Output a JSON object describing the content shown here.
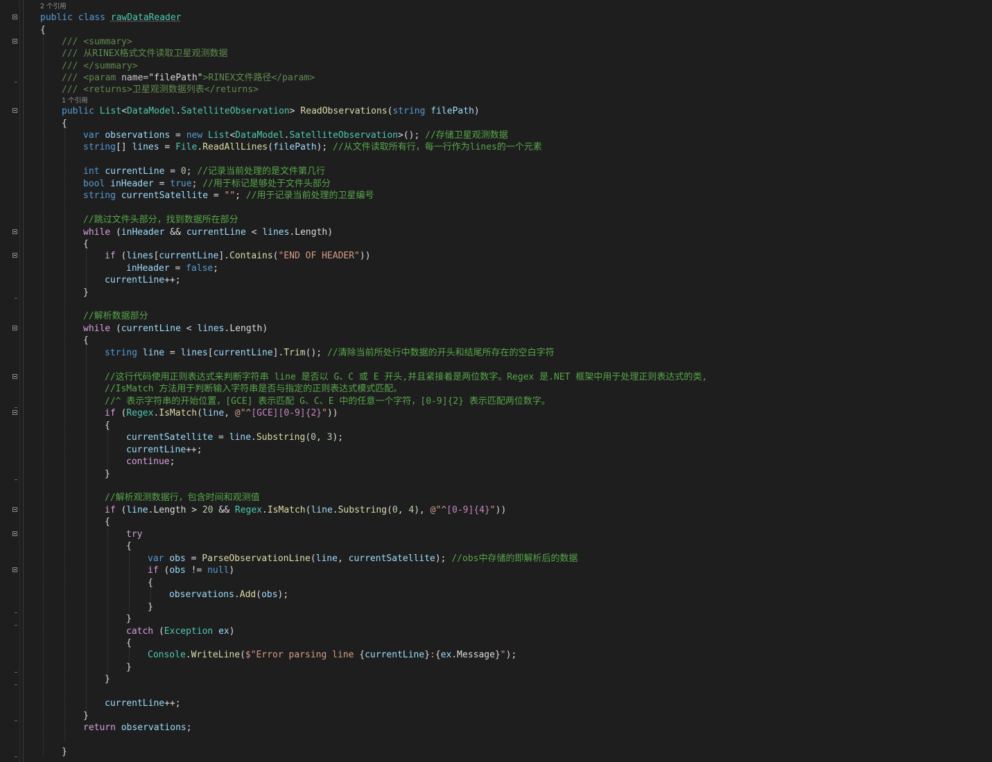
{
  "lens": {
    "class_refs": "2 个引用",
    "method_refs": "1 个引用"
  },
  "code": {
    "l01": [
      "public",
      "class",
      "rawDataReader"
    ],
    "l02": "{",
    "l03": "/// <summary>",
    "l04": "/// 从RINEX格式文件读取卫星观测数据",
    "l05": "/// </summary>",
    "l06": [
      "/// <param ",
      "name=",
      "\"filePath\"",
      ">RINEX文件路径</param>"
    ],
    "l07": "/// <returns>卫星观测数据列表</returns>",
    "l08": [
      "public",
      "List",
      "<",
      "DataModel",
      ".",
      "SatelliteObservation",
      "> ",
      "ReadObservations",
      "(",
      "string",
      "filePath",
      ")"
    ],
    "l09": "{",
    "l10": [
      "var",
      "observations",
      " = ",
      "new",
      "List",
      "<",
      "DataModel",
      ".",
      "SatelliteObservation",
      ">(); ",
      "//存储卫星观测数据"
    ],
    "l11": [
      "string",
      "[] ",
      "lines",
      " = ",
      "File",
      ".",
      "ReadAllLines",
      "(",
      "filePath",
      "); ",
      "//从文件读取所有行，每一行作为lines的一个元素"
    ],
    "l12": [
      "int",
      "currentLine",
      " = ",
      "0",
      "; ",
      "//记录当前处理的是文件第几行"
    ],
    "l13": [
      "bool",
      "inHeader",
      " = ",
      "true",
      "; ",
      "//用于标记是够处于文件头部分"
    ],
    "l14": [
      "string",
      "currentSatellite",
      " = ",
      "\"\"",
      "; ",
      "//用于记录当前处理的卫星编号"
    ],
    "l15": "//跳过文件头部分，找到数据所在部分",
    "l16": [
      "while",
      " (",
      "inHeader",
      " && ",
      "currentLine",
      " < ",
      "lines",
      ".",
      "Length",
      ")"
    ],
    "l17": "{",
    "l18": [
      "if",
      " (",
      "lines",
      "[",
      "currentLine",
      "].",
      "Contains",
      "(",
      "\"END OF HEADER\"",
      "))"
    ],
    "l19": [
      "inHeader",
      " = ",
      "false",
      ";"
    ],
    "l20": [
      "currentLine",
      "++;"
    ],
    "l21": "}",
    "l22": "//解析数据部分",
    "l23": [
      "while",
      " (",
      "currentLine",
      " < ",
      "lines",
      ".",
      "Length",
      ")"
    ],
    "l24": "{",
    "l25": [
      "string",
      "line",
      " = ",
      "lines",
      "[",
      "currentLine",
      "].",
      "Trim",
      "(); ",
      "//清除当前所处行中数据的开头和结尾所存在的空白字符"
    ],
    "l26": "//这行代码使用正则表达式来判断字符串 line 是否以 G、C 或 E 开头,并且紧接着是两位数字。Regex 是.NET 框架中用于处理正则表达式的类,",
    "l27": "//IsMatch 方法用于判断输入字符串是否与指定的正则表达式模式匹配。",
    "l28": "//^ 表示字符串的开始位置，[GCE] 表示匹配 G、C、E 中的任意一个字符，[0-9]{2} 表示匹配两位数字。",
    "l29": [
      "if",
      " (",
      "Regex",
      ".",
      "IsMatch",
      "(",
      "line",
      ", ",
      "@\"^",
      "[GCE]",
      "[0-9]",
      "{2}",
      "\"",
      "))"
    ],
    "l30": "{",
    "l31": [
      "currentSatellite",
      " = ",
      "line",
      ".",
      "Substring",
      "(",
      "0",
      ", ",
      "3",
      ");"
    ],
    "l32": [
      "currentLine",
      "++;"
    ],
    "l33": [
      "continue",
      ";"
    ],
    "l34": "}",
    "l35": "//解析观测数据行，包含时间和观测值",
    "l36": [
      "if",
      " (",
      "line",
      ".",
      "Length",
      " > ",
      "20",
      " && ",
      "Regex",
      ".",
      "IsMatch",
      "(",
      "line",
      ".",
      "Substring",
      "(",
      "0",
      ", ",
      "4",
      "), ",
      "@\"^",
      "[0-9]",
      "{4}",
      "\"",
      "))"
    ],
    "l37": "{",
    "l38": "try",
    "l39": "{",
    "l40": [
      "var",
      "obs",
      " = ",
      "ParseObservationLine",
      "(",
      "line",
      ", ",
      "currentSatellite",
      "); ",
      "//obs中存储的即解析后的数据"
    ],
    "l41": [
      "if",
      " (",
      "obs",
      " != ",
      "null",
      ")"
    ],
    "l42": "{",
    "l43": [
      "observations",
      ".",
      "Add",
      "(",
      "obs",
      ");"
    ],
    "l44": "}",
    "l45": "}",
    "l46": [
      "catch",
      " (",
      "Exception",
      "ex",
      ")"
    ],
    "l47": "{",
    "l48": [
      "Console",
      ".",
      "WriteLine",
      "(",
      "$\"Error parsing line ",
      "{",
      "currentLine",
      "}",
      ":",
      "{",
      "ex",
      ".",
      "Message",
      "}",
      "\"",
      ");"
    ],
    "l49": "}",
    "l50": "}",
    "l51": [
      "currentLine",
      "++;"
    ],
    "l52": "}",
    "l53": [
      "return",
      "observations",
      ";"
    ],
    "l54": "}"
  },
  "colors": {
    "background": "#1e1e1e",
    "keyword": "#569cd6",
    "control": "#d8a0df",
    "type": "#4ec9b0",
    "string": "#d69d85",
    "comment": "#57a64a",
    "method": "#dcdcaa",
    "variable": "#9cdcfe"
  }
}
